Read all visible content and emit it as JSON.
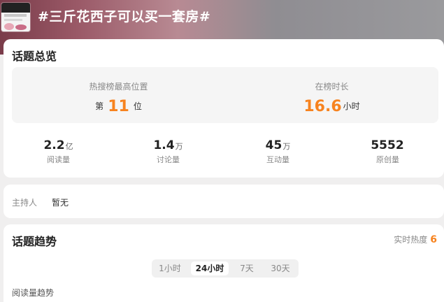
{
  "header": {
    "title": "#三斤花西子可以买一套房#"
  },
  "overview": {
    "title": "话题总览",
    "hot_rank": {
      "label": "热搜榜最高位置",
      "prefix": "第",
      "value": "11",
      "suffix": "位"
    },
    "on_board": {
      "label": "在榜时长",
      "value": "16.6",
      "unit": "小时"
    },
    "stats": [
      {
        "value": "2.2",
        "unit": "亿",
        "label": "阅读量"
      },
      {
        "value": "1.4",
        "unit": "万",
        "label": "讨论量"
      },
      {
        "value": "45",
        "unit": "万",
        "label": "互动量"
      },
      {
        "value": "5552",
        "unit": "",
        "label": "原创量"
      }
    ]
  },
  "host": {
    "label": "主持人",
    "value": "暂无"
  },
  "trend": {
    "title": "话题趋势",
    "realtime_label": "实时热度",
    "realtime_value": "6",
    "tabs": [
      {
        "label": "1小时",
        "active": false
      },
      {
        "label": "24小时",
        "active": true
      },
      {
        "label": "7天",
        "active": false
      },
      {
        "label": "30天",
        "active": false
      }
    ],
    "subtitle": "阅读量趋势"
  },
  "colors": {
    "accent": "#f7831f"
  }
}
